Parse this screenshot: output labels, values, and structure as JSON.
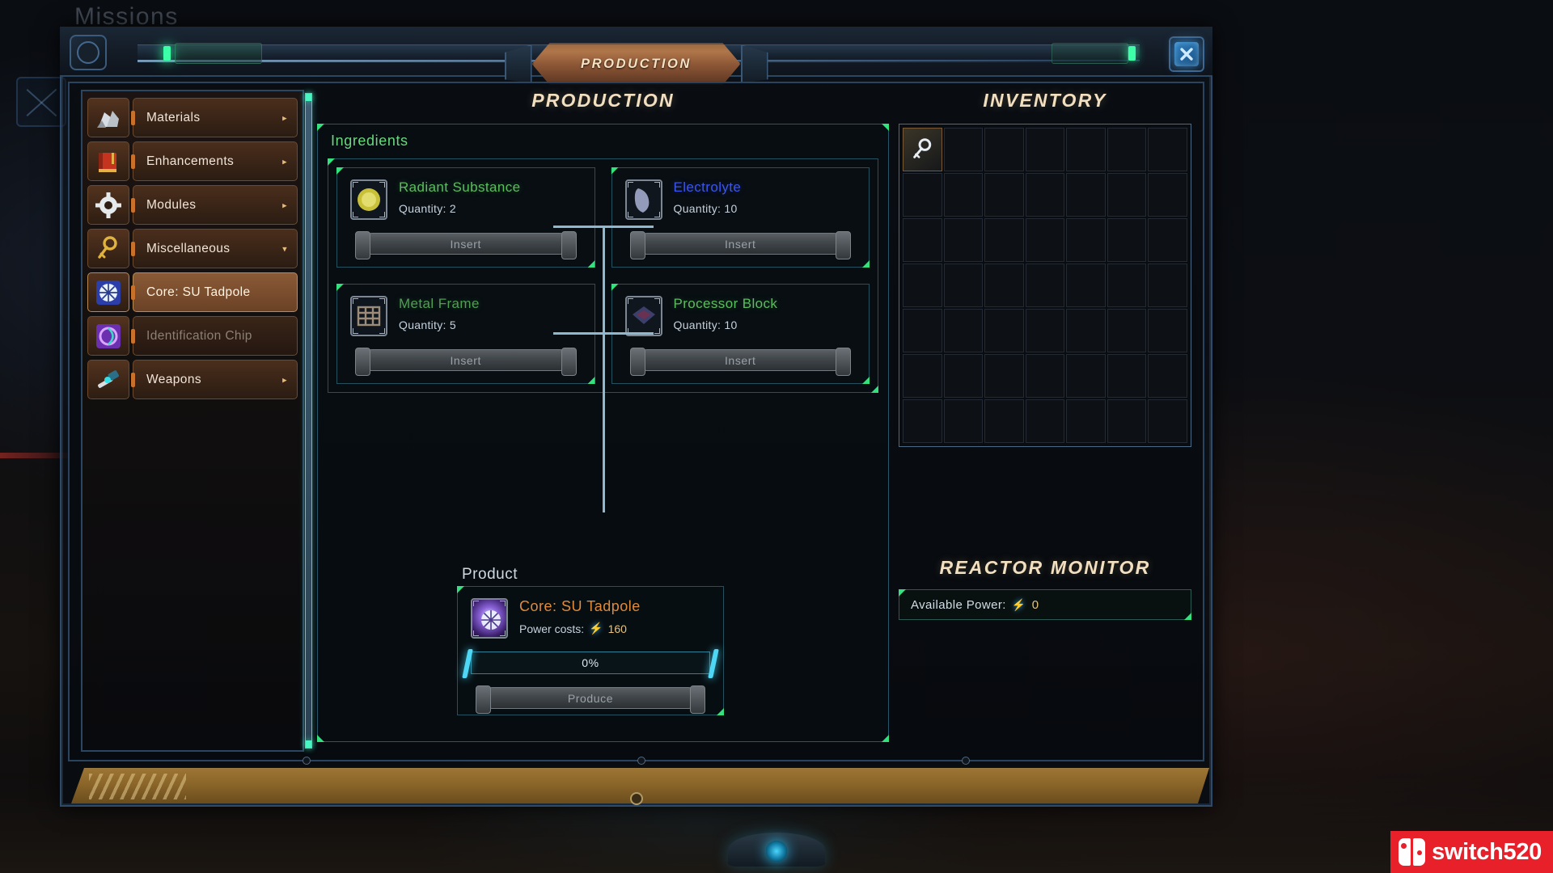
{
  "background": {
    "missions_label": "Missions"
  },
  "window": {
    "title": "PRODUCTION",
    "close_label": "×"
  },
  "sidebar": {
    "items": [
      {
        "label": "Materials",
        "icon": "rock-icon",
        "state": "normal",
        "arrow": "▸"
      },
      {
        "label": "Enhancements",
        "icon": "book-icon",
        "state": "normal",
        "arrow": "▸"
      },
      {
        "label": "Modules",
        "icon": "gear-icon",
        "state": "normal",
        "arrow": "▸"
      },
      {
        "label": "Miscellaneous",
        "icon": "key-icon",
        "state": "normal",
        "arrow": "▾"
      },
      {
        "label": "Core: SU Tadpole",
        "icon": "core-icon",
        "state": "selected",
        "arrow": ""
      },
      {
        "label": "Identification Chip",
        "icon": "chip-icon",
        "state": "dim",
        "arrow": ""
      },
      {
        "label": "Weapons",
        "icon": "weapon-icon",
        "state": "normal",
        "arrow": "▸"
      }
    ]
  },
  "production": {
    "heading": "PRODUCTION",
    "ingredients_label": "Ingredients",
    "ingredients": [
      {
        "name": "Radiant Substance",
        "quantity": "Quantity: 2",
        "button": "Insert",
        "color": "#5bbd5e",
        "thumb": "radiant-substance-thumb"
      },
      {
        "name": "Electrolyte",
        "quantity": "Quantity: 10",
        "button": "Insert",
        "color": "#3b55ee",
        "thumb": "electrolyte-thumb"
      },
      {
        "name": "Metal Frame",
        "quantity": "Quantity: 5",
        "button": "Insert",
        "color": "#4f9e52",
        "thumb": "metal-frame-thumb"
      },
      {
        "name": "Processor Block",
        "quantity": "Quantity: 10",
        "button": "Insert",
        "color": "#5bbd5e",
        "thumb": "processor-block-thumb"
      }
    ],
    "product_label": "Product",
    "product": {
      "name": "Core: SU Tadpole",
      "power_label": "Power costs:",
      "power_value": "160",
      "power_icon": "lightning-bolt-icon",
      "progress_text": "0%",
      "progress_percent": 0,
      "produce_button": "Produce"
    }
  },
  "inventory": {
    "heading": "INVENTORY",
    "columns": 7,
    "rows": 7,
    "slots": [
      {
        "index": 0,
        "filled": true,
        "icon": "key-item-icon"
      }
    ]
  },
  "reactor": {
    "heading": "REACTOR MONITOR",
    "available_power_label": "Available Power:",
    "available_power_value": "0",
    "power_icon": "lightning-bolt-icon"
  },
  "watermark": {
    "text": "switch520",
    "logo": "nintendo-switch-logo"
  },
  "colors": {
    "accent_green": "#33e27f",
    "accent_copper": "#b0764a",
    "accent_blue": "#4fd8f5",
    "title_cream": "#f2dfc0"
  }
}
